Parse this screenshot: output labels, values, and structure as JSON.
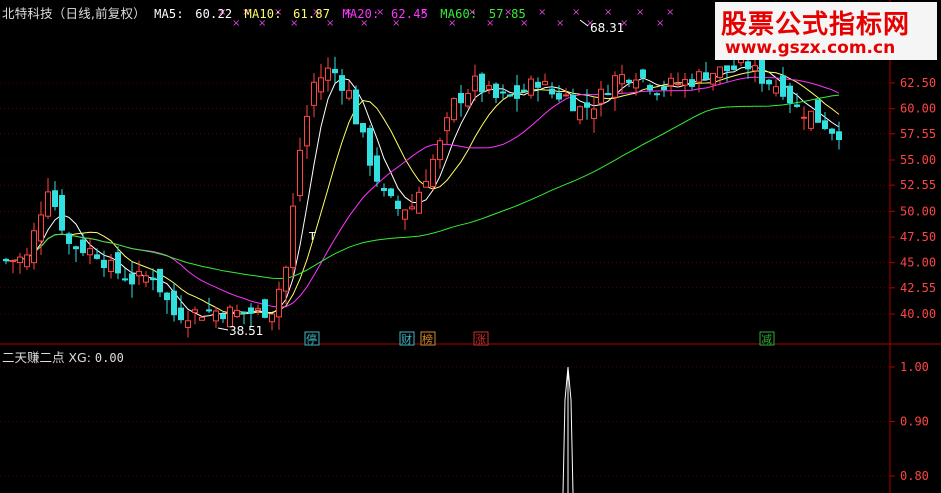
{
  "main_panel": {
    "legend": {
      "title": "北特科技（日线,前复权）",
      "ma5": {
        "label": "MA5:",
        "value": "60.22",
        "color": "#ffffff"
      },
      "ma10": {
        "label": "MA10:",
        "value": "61.87",
        "color": "#ffff66"
      },
      "ma20": {
        "label": "MA20:",
        "value": "62.45",
        "color": "#ff33ff"
      },
      "ma60": {
        "label": "MA60:",
        "value": "57.85",
        "color": "#33ee33"
      }
    },
    "price_axis": [
      "62.50",
      "60.00",
      "57.55",
      "55.00",
      "52.55",
      "50.00",
      "47.50",
      "45.00",
      "42.55",
      "40.00"
    ],
    "annotations": {
      "high_label": "68.31",
      "low_label": "38.51",
      "t_marker": "T"
    },
    "event_badges": [
      {
        "label": "停",
        "color": "#3fb8c8"
      },
      {
        "label": "财",
        "color": "#3fb8c8"
      },
      {
        "label": "榜",
        "color": "#d88a2a"
      },
      {
        "label": "涨",
        "color": "#d0302a"
      },
      {
        "label": "减",
        "color": "#33aa33"
      }
    ],
    "marker_glyph": "×",
    "colors": {
      "up": "#ff4444",
      "down": "#33e0e0",
      "grid": "#8b0000"
    }
  },
  "sub_panel": {
    "indicator_label": "二天赚二点 XG:",
    "indicator_value": "0.00",
    "axis": [
      "1.00",
      "0.90",
      "0.80"
    ]
  },
  "watermark": {
    "title": "股票公式指标网",
    "url": "www.gszx.com.cn"
  },
  "chart_data": {
    "type": "line",
    "title": "北特科技（日线,前复权）",
    "ylim": [
      38.5,
      67.0
    ],
    "y_ticks": [
      40.0,
      42.55,
      45.0,
      47.5,
      50.0,
      52.55,
      55.0,
      57.55,
      60.0,
      62.5
    ],
    "series": [
      {
        "name": "MA5",
        "last_value": 60.22
      },
      {
        "name": "MA10",
        "last_value": 61.87
      },
      {
        "name": "MA20",
        "last_value": 62.45
      },
      {
        "name": "MA60",
        "last_value": 57.85
      }
    ],
    "annotations": {
      "high": 68.31,
      "low": 38.51
    },
    "sub_series": {
      "name": "XG",
      "last_value": 0.0,
      "ylim": [
        0.78,
        1.02
      ],
      "y_ticks": [
        0.8,
        0.9,
        1.0
      ]
    }
  }
}
